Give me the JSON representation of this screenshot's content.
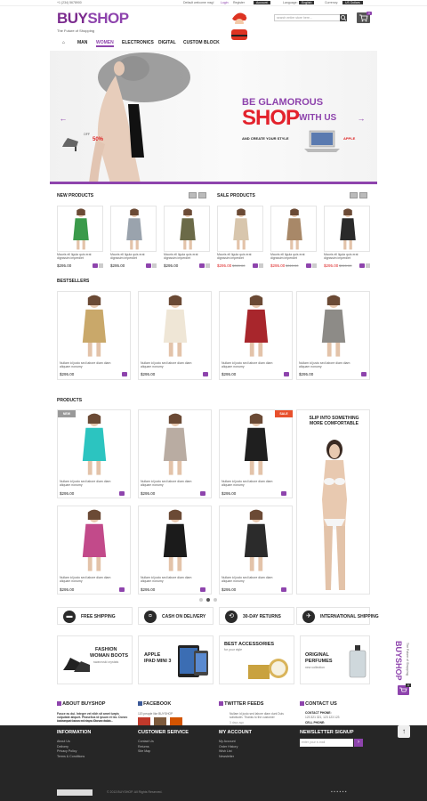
{
  "topbar": {
    "phone": "+1 (234) 5678900",
    "welcome": "Default welcome msg!",
    "login": "Login",
    "or": "or",
    "register": "Register",
    "account": "Account",
    "language_label": "Language:",
    "language": "English",
    "currency_label": "Currency:",
    "currency": "US Dollars"
  },
  "header": {
    "logo_buy": "BUY",
    "logo_shop": "SHOP",
    "tagline": "The Future of Shopping",
    "search_placeholder": "search entire store here...",
    "cart_count": "0"
  },
  "nav": {
    "items": [
      "MAN",
      "WOMEN",
      "ELECTRONICS",
      "DIGITAL",
      "CUSTOM BLOCK"
    ],
    "active": "WOMEN"
  },
  "banner": {
    "line1": "BE GLAMOROUS",
    "line2": "SHOP",
    "line3": "WITH US",
    "line4": "AND CREATE YOUR STYLE",
    "discount": "50%",
    "discount_label": "OFF",
    "apple": "APPLE"
  },
  "new_products": {
    "title": "NEW PRODUCTS",
    "items": [
      {
        "text": "Mauris ell ligula quis erat dignissim imperdiet",
        "price": "$295.00",
        "color": "#3a9a4a"
      },
      {
        "text": "Mauris ell ligula quis erat dignissim imperdiet",
        "price": "$295.00",
        "color": "#9aa3ad"
      },
      {
        "text": "Mauris ell ligula quis erat dignissim imperdiet",
        "price": "$295.00",
        "color": "#6b6a48"
      }
    ]
  },
  "sale_products": {
    "title": "SALE PRODUCTS",
    "items": [
      {
        "text": "Mauris ell ligula quis erat dignissim imperdiet",
        "price": "$295.00",
        "old": "$310.00",
        "color": "#d8c6ad"
      },
      {
        "text": "Mauris ell ligula quis erat dignissim imperdiet",
        "price": "$295.00",
        "old": "$310.00",
        "color": "#a88868"
      },
      {
        "text": "Mauris ell ligula quis erat dignissim imperdiet",
        "price": "$295.00",
        "old": "$310.00",
        "color": "#2a2a2a"
      }
    ]
  },
  "bestsellers": {
    "title": "BESTSELLERS",
    "items": [
      {
        "text": "Nullam id justo sed labore diam diam aliquam nonumy",
        "price": "$295.00",
        "color": "#c9a86a"
      },
      {
        "text": "Nullam id justo sed labore diam diam aliquam nonumy",
        "price": "$295.00",
        "color": "#efe6d6"
      },
      {
        "text": "Nullam id justo sed labore diam diam aliquam nonumy",
        "price": "$295.00",
        "color": "#a8262c"
      },
      {
        "text": "Nullam id justo sed labore diam diam aliquam nonumy",
        "price": "$295.00",
        "color": "#8d8b87"
      }
    ]
  },
  "products": {
    "title": "PRODUCTS",
    "items": [
      {
        "text": "Nullam id justo sed labore diam diam aliquam nonumy",
        "price": "$295.00",
        "color": "#2cc4c0",
        "badge": "NEW"
      },
      {
        "text": "Nullam id justo sed labore diam diam aliquam nonumy",
        "price": "$295.00",
        "color": "#b9aca2",
        "badge": ""
      },
      {
        "text": "Nullam id justo sed labore diam diam aliquam nonumy",
        "price": "$295.00",
        "color": "#1f1f1f",
        "badge": "SALE"
      },
      {
        "text": "Nullam id justo sed labore diam diam aliquam nonumy",
        "price": "$295.00",
        "color": "#c24a8a",
        "badge": ""
      },
      {
        "text": "Nullam id justo sed labore diam diam aliquam nonumy",
        "price": "$295.00",
        "color": "#1b1b1b",
        "badge": ""
      },
      {
        "text": "Nullam id justo sed labore diam diam aliquam nonumy",
        "price": "$295.00",
        "color": "#2b2b2b",
        "badge": ""
      }
    ],
    "promo_text": "SLIP INTO SOMETHING MORE COMFORTABLE"
  },
  "features": [
    "FREE SHIPPING",
    "CASH ON DELIVERY",
    "30-DAY RETURNS",
    "INTERNATIONAL SHIPPING"
  ],
  "promos": {
    "fashion": "FASHION",
    "woman_boots": "WOMAN BOOTS",
    "boots_sub": "swarovski crystals",
    "apple": "APPLE",
    "ipad": "IPAD MINI 3",
    "best": "BEST ACCESSORIES",
    "best_sub": "for your style",
    "original": "ORIGINAL",
    "perfumes": "PERFUMES",
    "perf_sub": "new collection"
  },
  "footer": {
    "about_title": "ABOUT BUYSHOP",
    "about_text": "Fusce eu dui. Integer vel nibh sit amet turpis vulputate aliquet. Phasellus id ipsum et leo. Donec consequat lacus ed risus. Donec dolor...",
    "about_text2": "Nullam ac nisi non eros gravida venenatis.",
    "facebook_title": "FACEBOOK",
    "facebook_text": "120 people like BUYSHOP",
    "twitter_title": "TWITTER FEEDS",
    "tweet1": "Nullam id justo sed labore diam dunt Duis solicitudin. Thanks to the customer",
    "tweet_time": "3 days ago",
    "contact_title": "CONTACT US",
    "contact_phone_label": "CONTACT PHONE:",
    "contact_phone": "123 321 321, 123 123 123",
    "cell_label": "CELL PHONE:",
    "cell_phone": "123 321 321, 123 123 123",
    "email_label": "E-MAIL",
    "info_title": "INFORMATION",
    "info_items": [
      "About Us",
      "Delivery",
      "Privacy Policy",
      "Terms & Conditions"
    ],
    "service_title": "CUSTOMER SERVICE",
    "service_items": [
      "Contact Us",
      "Returns",
      "Site Map"
    ],
    "account_title": "MY ACCOUNT",
    "account_items": [
      "My Account",
      "Order History",
      "Wish List",
      "Newsletter"
    ],
    "newsletter_title": "NEWSLETTER SIGNUP",
    "newsletter_placeholder": "enter your e-mail",
    "copyright": "© 2013 BUYSHOP. All Rights Reserved."
  },
  "side": {
    "logo": "BUYSHOP",
    "tagline": "The Future of Shopping",
    "cart_count": "0"
  },
  "colors": {
    "accent": "#8e44ad",
    "dark": "#262626",
    "sale_red": "#dd2222"
  }
}
